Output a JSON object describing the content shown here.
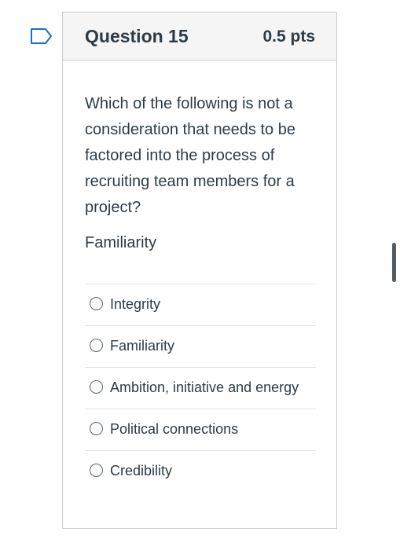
{
  "question": {
    "title": "Question 15",
    "points": "0.5 pts",
    "text": "Which of the following is not a consideration that needs to be factored into the process of recruiting team members for a project?",
    "note": "Familiarity"
  },
  "answers": [
    {
      "label": "Integrity"
    },
    {
      "label": "Familiarity"
    },
    {
      "label": "Ambition, initiative and energy"
    },
    {
      "label": "Political connections"
    },
    {
      "label": "Credibility"
    }
  ],
  "icons": {
    "flag": "bookmark-flag-icon",
    "accent": "#1771c5"
  }
}
